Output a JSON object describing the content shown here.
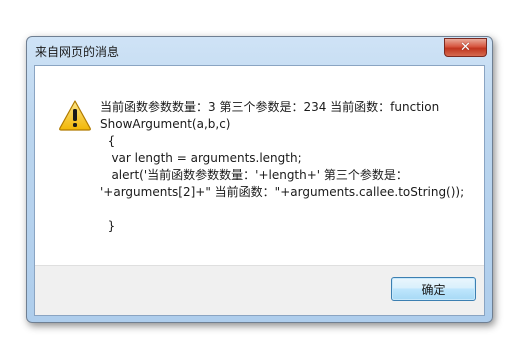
{
  "dialog": {
    "title": "来自网页的消息",
    "icon": "warning-icon",
    "message": "当前函数参数数量：3 第三个参数是：234 当前函数：function\nShowArgument(a,b,c)\n  {\n   var length = arguments.length;\n   alert('当前函数参数数量：'+length+' 第三个参数是：\n'+arguments[2]+\" 当前函数：\"+arguments.callee.toString());\n\n  }",
    "ok_label": "确定"
  },
  "colors": {
    "frame": "#aecdec",
    "close_button": "#c0351f",
    "warning_fill": "#f5c518",
    "ok_border": "#3c7fb1"
  }
}
